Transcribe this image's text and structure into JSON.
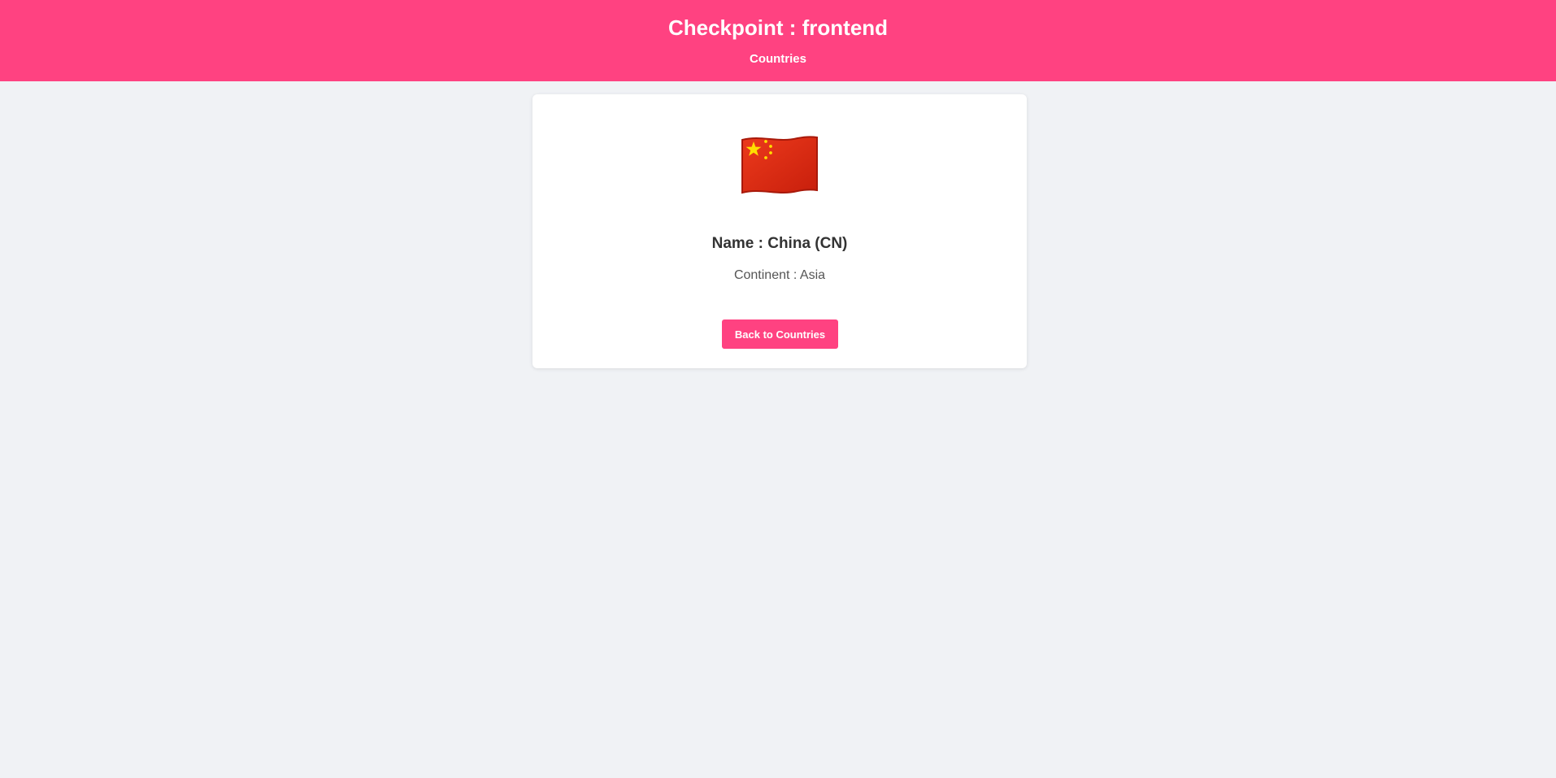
{
  "header": {
    "title": "Checkpoint : frontend",
    "nav_link": "Countries"
  },
  "country": {
    "flag_icon": "china-flag-icon",
    "name_line": "Name : China (CN)",
    "continent_line": "Continent : Asia"
  },
  "actions": {
    "back_label": "Back to Countries"
  },
  "colors": {
    "accent": "#ff4281",
    "page_background": "#f0f2f5",
    "card_background": "#ffffff",
    "flag_red": "#de2910",
    "flag_yellow": "#ffde00"
  }
}
